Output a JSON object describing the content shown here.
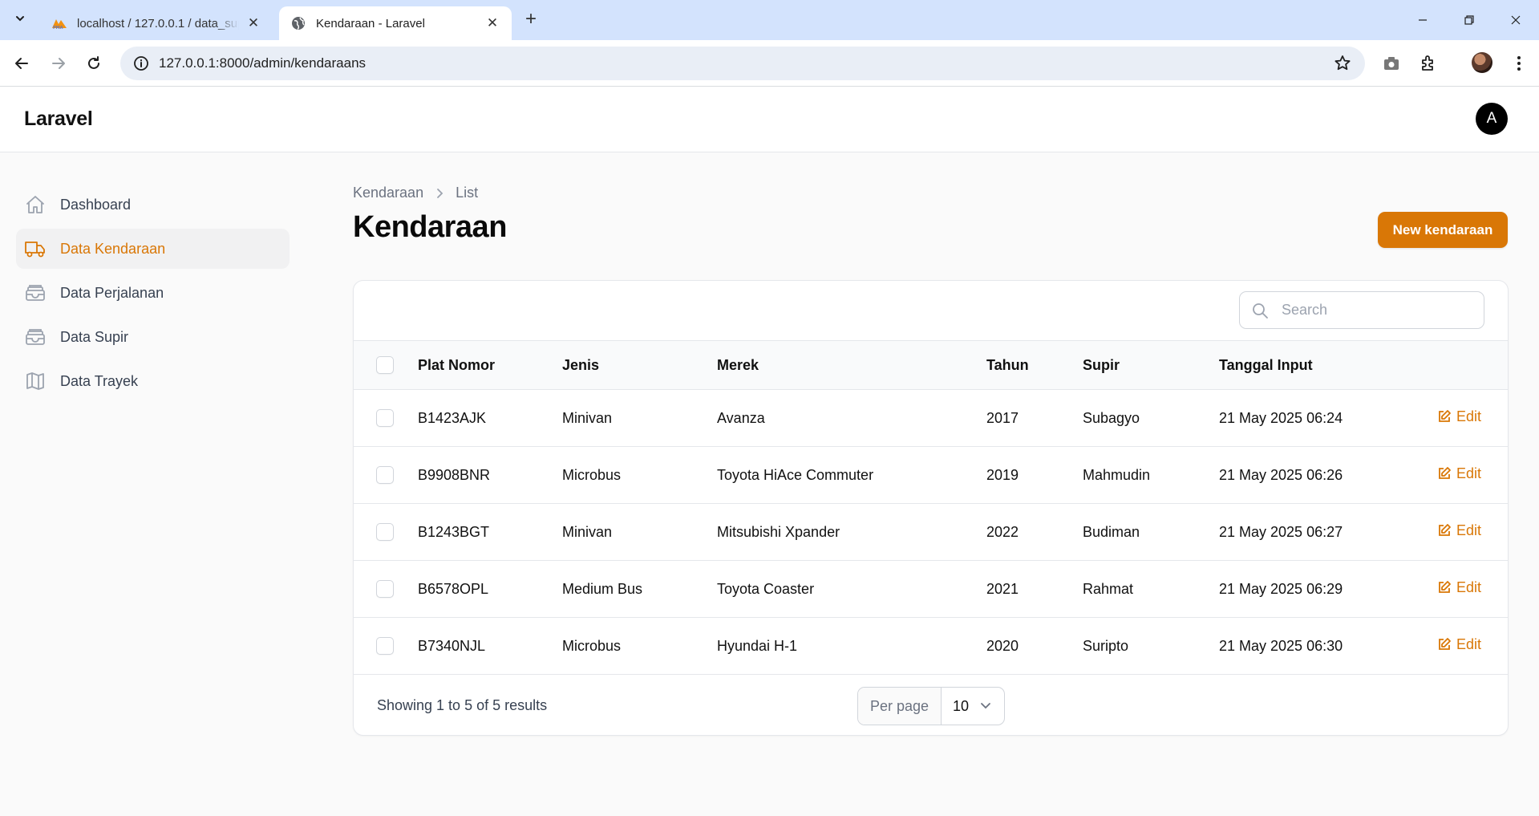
{
  "browser": {
    "tabs": [
      {
        "title": "localhost / 127.0.0.1 / data_supir",
        "active": false
      },
      {
        "title": "Kendaraan - Laravel",
        "active": true
      }
    ],
    "url": "127.0.0.1:8000/admin/kendaraans"
  },
  "app": {
    "brand": "Laravel",
    "avatar_initial": "A"
  },
  "sidebar": {
    "items": [
      {
        "label": "Dashboard",
        "icon": "home-icon",
        "active": false
      },
      {
        "label": "Data Kendaraan",
        "icon": "truck-icon",
        "active": true
      },
      {
        "label": "Data Perjalanan",
        "icon": "inbox-stack-icon",
        "active": false
      },
      {
        "label": "Data Supir",
        "icon": "inbox-stack-icon",
        "active": false
      },
      {
        "label": "Data Trayek",
        "icon": "map-icon",
        "active": false
      }
    ]
  },
  "page": {
    "breadcrumb": [
      "Kendaraan",
      "List"
    ],
    "title": "Kendaraan",
    "new_button": "New kendaraan"
  },
  "table": {
    "search_placeholder": "Search",
    "headers": [
      "Plat Nomor",
      "Jenis",
      "Merek",
      "Tahun",
      "Supir",
      "Tanggal Input"
    ],
    "edit_label": "Edit",
    "rows": [
      [
        "B1423AJK",
        "Minivan",
        "Avanza",
        "2017",
        "Subagyo",
        "21 May 2025 06:24"
      ],
      [
        "B9908BNR",
        "Microbus",
        "Toyota HiAce Commuter",
        "2019",
        "Mahmudin",
        "21 May 2025 06:26"
      ],
      [
        "B1243BGT",
        "Minivan",
        "Mitsubishi Xpander",
        "2022",
        "Budiman",
        "21 May 2025 06:27"
      ],
      [
        "B6578OPL",
        "Medium Bus",
        "Toyota Coaster",
        "2021",
        "Rahmat",
        "21 May 2025 06:29"
      ],
      [
        "B7340NJL",
        "Microbus",
        "Hyundai H-1",
        "2020",
        "Suripto",
        "21 May 2025 06:30"
      ]
    ],
    "summary": "Showing 1 to 5 of 5 results",
    "per_page_label": "Per page",
    "per_page_value": "10"
  },
  "colors": {
    "accent": "#d97706",
    "browser_frame": "#d3e3fd"
  }
}
